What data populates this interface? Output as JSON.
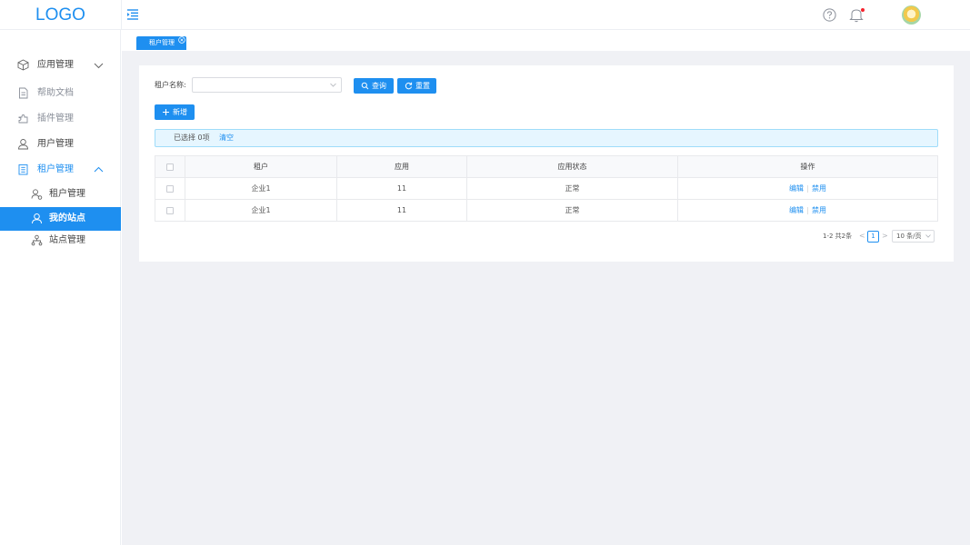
{
  "header": {
    "logo": "LOGO",
    "colors": {
      "accent": "#1e8ff0",
      "background": "#f0f1f5",
      "notification_dot": "#f5222d"
    },
    "icons": [
      "menu-fold-icon",
      "question-circle-icon",
      "bell-icon",
      "avatar"
    ]
  },
  "sidebar": {
    "items": [
      {
        "label": "应用管理",
        "icon": "cube-icon",
        "expanded": false
      },
      {
        "label": "帮助文档",
        "icon": "document-icon"
      },
      {
        "label": "插件管理",
        "icon": "plugin-icon"
      },
      {
        "label": "用户管理",
        "icon": "user-icon"
      },
      {
        "label": "租户管理",
        "icon": "building-icon",
        "expanded": true
      },
      {
        "label": "租户管理",
        "icon": "user-group-icon",
        "sub": true
      },
      {
        "label": "我的站点",
        "icon": "user-icon",
        "sub": true,
        "active": true
      },
      {
        "label": "站点管理",
        "icon": "sitemap-icon",
        "sub": true
      }
    ]
  },
  "tabs": [
    {
      "label": "租户管理",
      "active": true
    }
  ],
  "search": {
    "field_label": "租户名称:",
    "select_value": "",
    "query_button": "查询",
    "reset_button": "重置"
  },
  "toolbar": {
    "add_button": "新增"
  },
  "selection": {
    "text": "已选择 0项",
    "clear": "清空"
  },
  "table": {
    "columns": [
      "租户",
      "应用",
      "应用状态",
      "操作"
    ],
    "rows": [
      {
        "tenant": "企业1",
        "apps": "11",
        "status": "正常",
        "edit": "编辑",
        "disable": "禁用"
      },
      {
        "tenant": "企业1",
        "apps": "11",
        "status": "正常",
        "edit": "编辑",
        "disable": "禁用"
      }
    ]
  },
  "pagination": {
    "total_text": "1-2 共2条",
    "prev": "<",
    "current_page": "1",
    "next": ">",
    "page_size": "10 条/页"
  }
}
